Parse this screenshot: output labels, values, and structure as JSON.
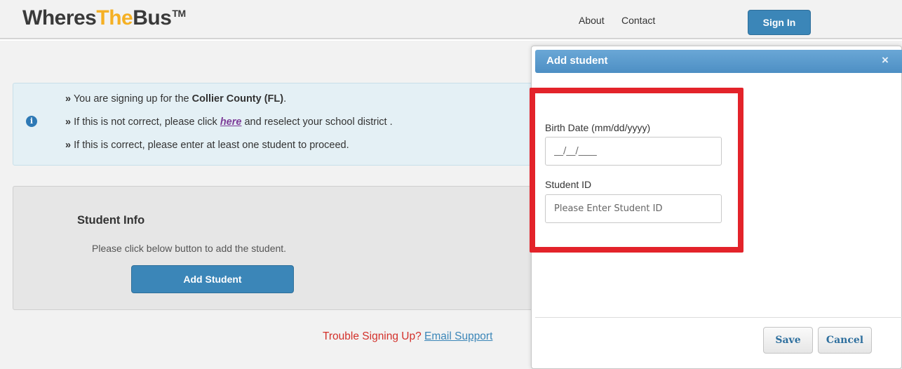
{
  "header": {
    "logo_part1": "Wheres",
    "logo_part2": "The",
    "logo_part3": "Bus",
    "logo_tm": "TM",
    "nav_about": "About",
    "nav_contact": "Contact",
    "signin_label": "Sign In"
  },
  "alert": {
    "icon": "info-icon",
    "bullet": "»",
    "line1_prefix": " You are signing up for the ",
    "line1_bold": "Collier County (FL)",
    "line1_suffix": ".",
    "line2_prefix": " If this is not correct, please click ",
    "line2_link": "here",
    "line2_suffix": " and reselect your school district .",
    "line3": " If this is correct, please enter at least one student to proceed."
  },
  "student_info": {
    "title": "Student Info",
    "text": "Please click below button to add the student.",
    "add_button": "Add Student"
  },
  "footer": {
    "trouble_text": "Trouble Signing Up? ",
    "email_link": "Email Support"
  },
  "modal": {
    "title": "Add student",
    "close": "×",
    "birth_label": "Birth Date (mm/dd/yyyy)",
    "birth_placeholder": "__/__/____",
    "student_id_label": "Student ID",
    "student_id_placeholder": "Please Enter Student ID",
    "save_label": "Save",
    "cancel_label": "Cancel"
  },
  "colors": {
    "accent_blue": "#3b86b8",
    "logo_orange": "#f5b024",
    "highlight_red": "#e3232a",
    "trouble_red": "#d3302a"
  }
}
